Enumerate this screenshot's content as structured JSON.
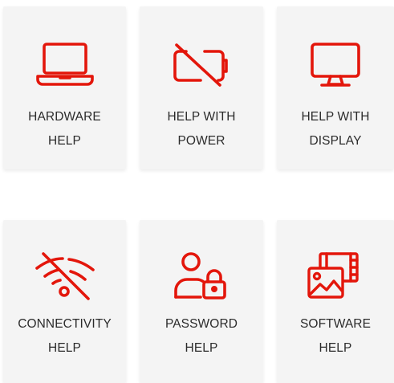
{
  "accent_color": "#e3160b",
  "cards": [
    {
      "line1": "HARDWARE",
      "line2": "HELP",
      "icon": "laptop-icon"
    },
    {
      "line1": "HELP WITH",
      "line2": "POWER",
      "icon": "battery-off-icon"
    },
    {
      "line1": "HELP WITH",
      "line2": "DISPLAY",
      "icon": "monitor-icon"
    },
    {
      "line1": "CONNECTIVITY",
      "line2": "HELP",
      "icon": "wifi-off-icon"
    },
    {
      "line1": "PASSWORD",
      "line2": "HELP",
      "icon": "user-lock-icon"
    },
    {
      "line1": "SOFTWARE",
      "line2": "HELP",
      "icon": "software-media-icon"
    }
  ]
}
